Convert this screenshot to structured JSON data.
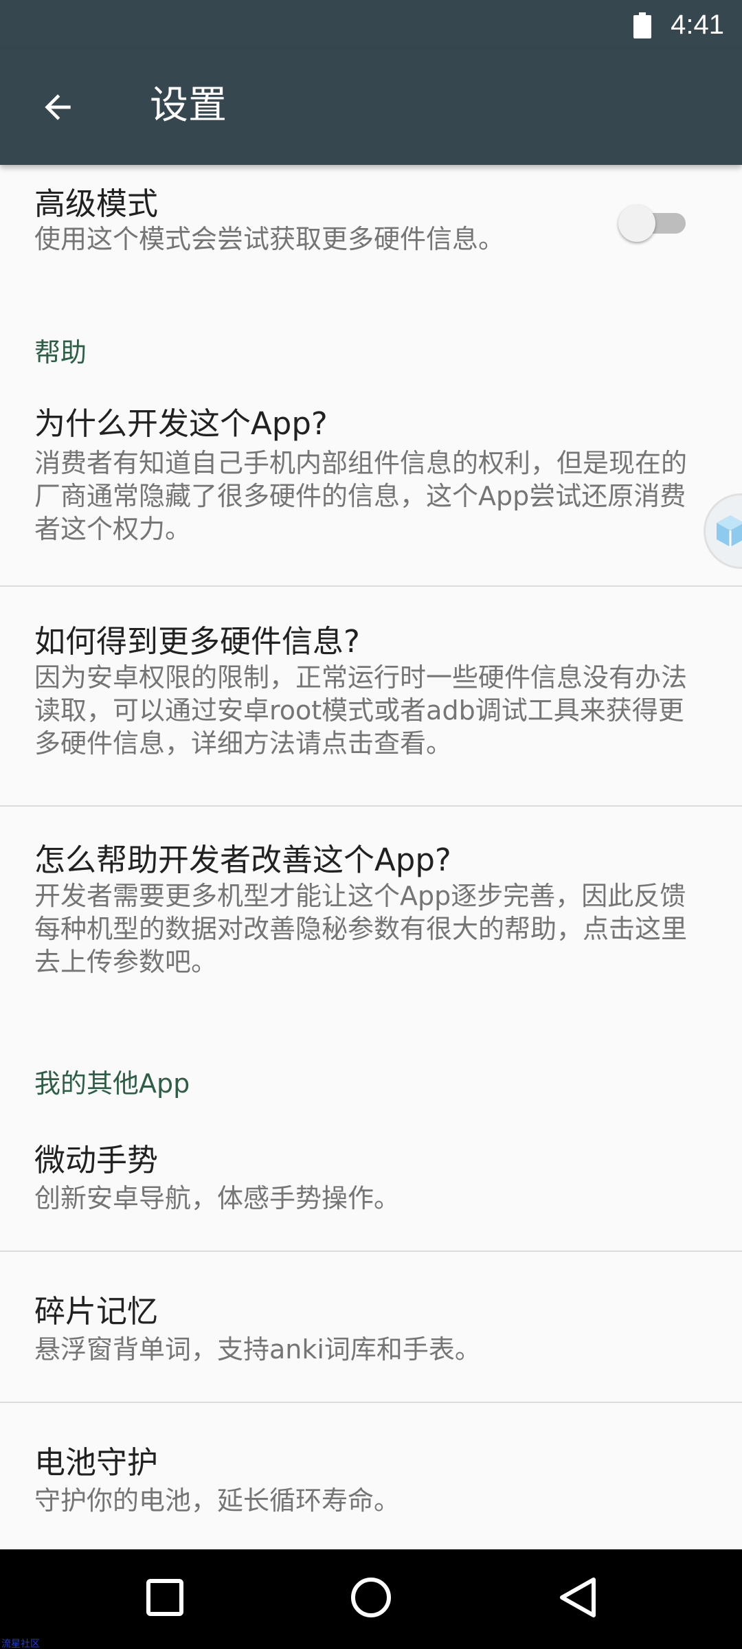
{
  "status_bar": {
    "time": "4:41",
    "battery_icon": "battery-full-icon"
  },
  "app_bar": {
    "back_icon": "arrow-back-icon",
    "title": "设置"
  },
  "advanced_mode": {
    "title": "高级模式",
    "summary": "使用这个模式会尝试获取更多硬件信息。",
    "enabled": false
  },
  "help_section": {
    "header": "帮助",
    "items": [
      {
        "title": "为什么开发这个App?",
        "summary": "消费者有知道自己手机内部组件信息的权利，但是现在的厂商通常隐藏了很多硬件的信息，这个App尝试还原消费者这个权力。"
      },
      {
        "title": "如何得到更多硬件信息?",
        "summary": "因为安卓权限的限制，正常运行时一些硬件信息没有办法读取，可以通过安卓root模式或者adb调试工具来获得更多硬件信息，详细方法请点击查看。"
      },
      {
        "title": "怎么帮助开发者改善这个App?",
        "summary": "开发者需要更多机型才能让这个App逐步完善，因此反馈每种机型的数据对改善隐秘参数有很大的帮助，点击这里去上传参数吧。"
      }
    ]
  },
  "other_apps_section": {
    "header": "我的其他App",
    "items": [
      {
        "title": "微动手势",
        "summary": "创新安卓导航，体感手势操作。"
      },
      {
        "title": "碎片记忆",
        "summary": "悬浮窗背单词，支持anki词库和手表。"
      },
      {
        "title": "电池守护",
        "summary": "守护你的电池，延长循环寿命。"
      }
    ]
  },
  "nav_bar": {
    "recents_icon": "recents-square-icon",
    "home_icon": "home-circle-icon",
    "back_icon": "back-triangle-icon"
  },
  "watermark": "流星社区",
  "colors": {
    "toolbar": "#37474f",
    "background": "#fafafa",
    "category_text": "#2e5e46",
    "primary_text": "#212121",
    "secondary_text": "#757575"
  }
}
